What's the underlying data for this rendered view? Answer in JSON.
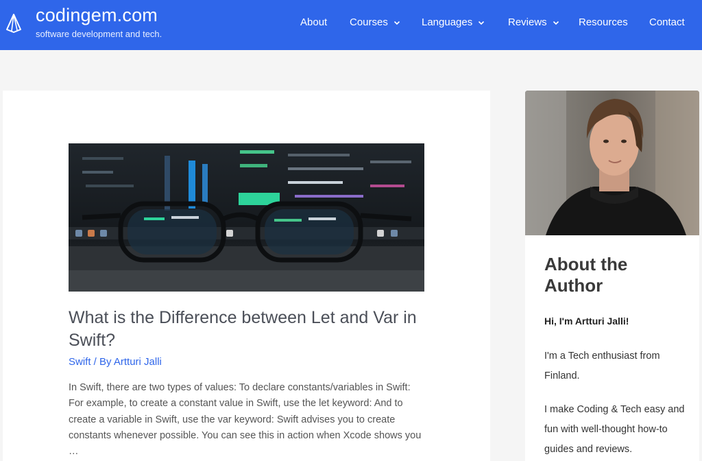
{
  "site": {
    "title": "codingem.com",
    "tagline": "software development and tech."
  },
  "nav": {
    "items": [
      {
        "label": "About",
        "has_dropdown": false
      },
      {
        "label": "Courses",
        "has_dropdown": true
      },
      {
        "label": "Languages",
        "has_dropdown": true
      },
      {
        "label": "Reviews",
        "has_dropdown": true
      },
      {
        "label": "Resources",
        "has_dropdown": false
      },
      {
        "label": "Contact",
        "has_dropdown": false
      }
    ]
  },
  "post": {
    "title": "What is the Difference between Let and Var in Swift?",
    "category": "Swift",
    "separator": " / By ",
    "author": "Artturi Jalli",
    "excerpt": "In Swift, there are two types of values: To declare constants/variables in Swift: For example, to create a constant value in Swift, use the let keyword: And to create a variable in Swift, use the var keyword: Swift advises you to create constants whenever possible. You can see this in action when Xcode shows you …"
  },
  "sidebar": {
    "widget_title": "About the Author",
    "greeting": "Hi, I'm Artturi Jalli!",
    "bio_1": "I'm a Tech enthusiast from Finland.",
    "bio_2": "I make Coding & Tech easy and fun with well-thought how-to guides and reviews."
  },
  "colors": {
    "header_bg": "#2f66ea",
    "link": "#2f66ea",
    "page_bg": "#f5f5f5"
  },
  "icons": [
    "logo-gem-icon",
    "chevron-down-icon"
  ]
}
